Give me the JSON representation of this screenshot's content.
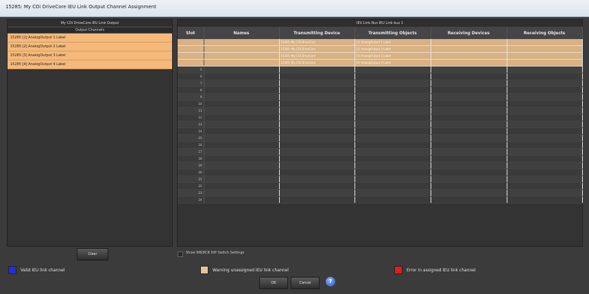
{
  "window": {
    "title": "15285: My CDi DriveCore IEU Link Output Channel Assignment"
  },
  "left_panel": {
    "header": "My CDi DriveCore  IEU Link Output",
    "subheader": "Output Channels",
    "channels": [
      "15285 [1] AnalogOutput 1 Label",
      "15285 [2] AnalogOutput 2 Label",
      "15285 [3] AnalogOutput 3 Label",
      "15285 [4] AnalogOutput 4 Label"
    ]
  },
  "right_panel": {
    "header": "IEU Link Bus  IEU Link bus 1",
    "columns": [
      "Slot",
      "Names",
      "Transmitting Device",
      "Transmitting Objects",
      "Receiving Devices",
      "Receiving Objects"
    ],
    "rows": [
      {
        "slot": "1",
        "names": "",
        "tx_device": "15285: My CDi DriveCore",
        "tx_objects": "[1] AnalogOutput 1 Label",
        "rx_devices": "",
        "rx_objects": ""
      },
      {
        "slot": "2",
        "names": "",
        "tx_device": "15285: My CDi DriveCore",
        "tx_objects": "[2] AnalogOutput 2 Label",
        "rx_devices": "",
        "rx_objects": ""
      },
      {
        "slot": "3",
        "names": "",
        "tx_device": "15285: My CDi DriveCore",
        "tx_objects": "[3] AnalogOutput 3 Label",
        "rx_devices": "",
        "rx_objects": ""
      },
      {
        "slot": "4",
        "names": "",
        "tx_device": "15285: My CDi DriveCore",
        "tx_objects": "[4] AnalogOutput 4 Label",
        "rx_devices": "",
        "rx_objects": ""
      },
      {
        "slot": "5"
      },
      {
        "slot": "6"
      },
      {
        "slot": "7"
      },
      {
        "slot": "8"
      },
      {
        "slot": "9"
      },
      {
        "slot": "10"
      },
      {
        "slot": "11"
      },
      {
        "slot": "12"
      },
      {
        "slot": "13"
      },
      {
        "slot": "14"
      },
      {
        "slot": "15"
      },
      {
        "slot": "16"
      },
      {
        "slot": "17"
      },
      {
        "slot": "18"
      },
      {
        "slot": "19"
      },
      {
        "slot": "20"
      },
      {
        "slot": "21"
      },
      {
        "slot": "22"
      },
      {
        "slot": "23"
      },
      {
        "slot": "24"
      }
    ]
  },
  "buttons": {
    "clear": "Clear",
    "ok": "OK",
    "cancel": "Cancel",
    "help": "?"
  },
  "checkbox": {
    "label": "Show 8IB/8CB DIP Switch Settings",
    "checked": false
  },
  "legend": [
    {
      "label": "Valid IEU link channel",
      "color": "#1f2ee0"
    },
    {
      "label": "Warning unassigned IEU link channel",
      "color": "#e6c49a"
    },
    {
      "label": "Error in assigned IEU link channel",
      "color": "#e01e1e"
    }
  ]
}
